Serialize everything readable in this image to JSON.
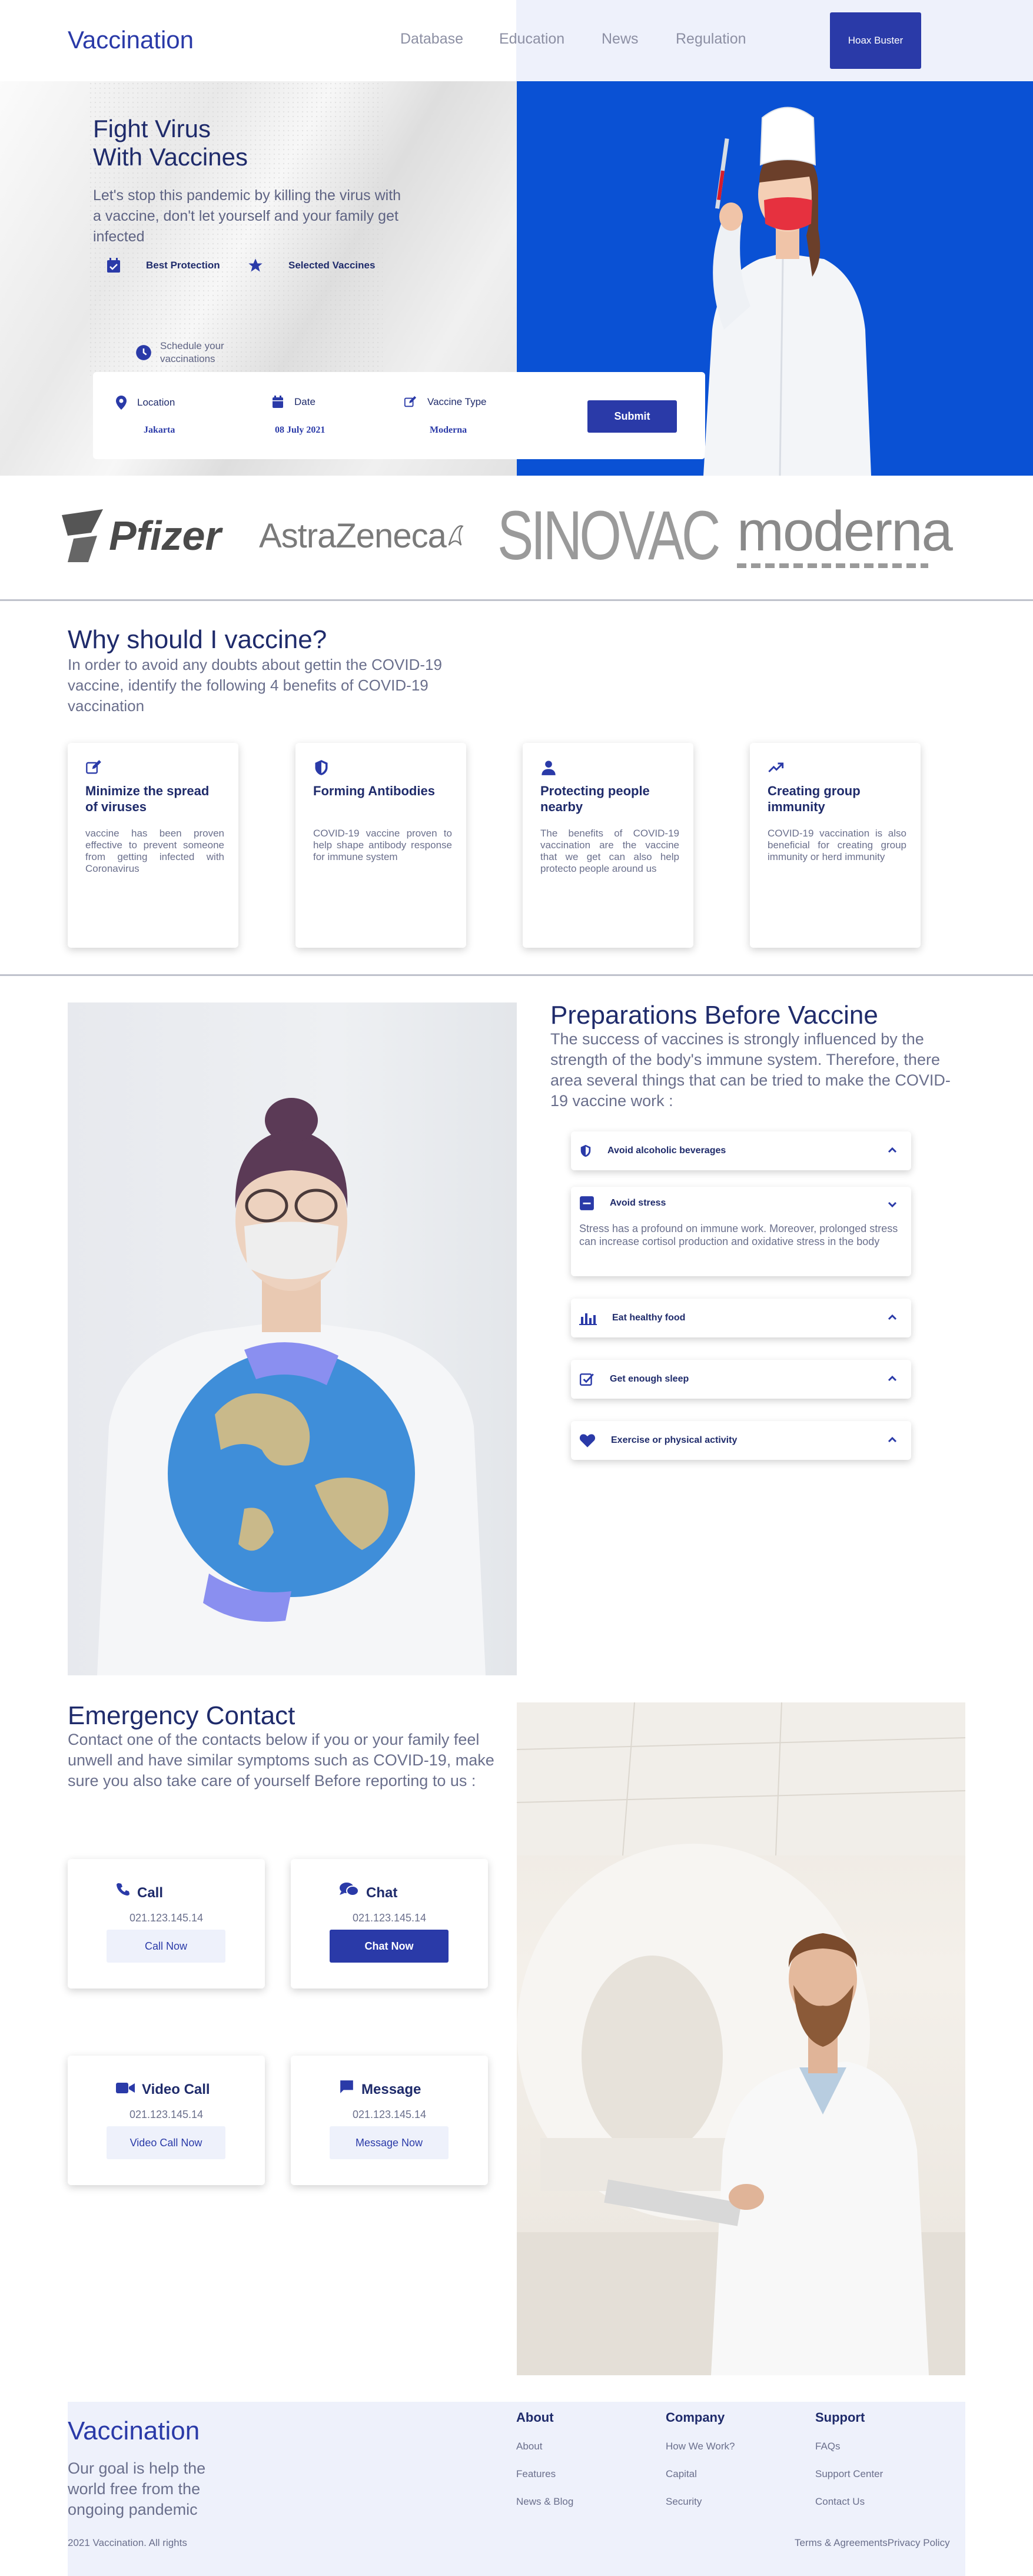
{
  "header": {
    "logo": "Vaccination",
    "nav": [
      "Database",
      "Education",
      "News",
      "Regulation"
    ],
    "cta": "Hoax Buster"
  },
  "hero": {
    "title_line1": "Fight Virus",
    "title_line2": "With Vaccines",
    "subtitle": "Let's stop this pandemic by killing the virus with a vaccine, don't let yourself and your family get infected",
    "features": [
      "Best Protection",
      "Selected Vaccines"
    ],
    "schedule_line1": "Schedule your",
    "schedule_line2": "vaccinations",
    "form": {
      "location_label": "Location",
      "location_value": "Jakarta",
      "date_label": "Date",
      "date_value": "08 July 2021",
      "type_label": "Vaccine Type",
      "type_value": "Moderna",
      "submit": "Submit"
    }
  },
  "brands": [
    "Pfizer",
    "AstraZeneca",
    "SINOVAC",
    "moderna"
  ],
  "why": {
    "title": "Why should I vaccine?",
    "subtitle": "In order to avoid any doubts about gettin the COVID-19 vaccine, identify the following 4 benefits of COVID-19 vaccination",
    "cards": [
      {
        "icon": "edit-icon",
        "title": "Minimize the spread of viruses",
        "text": "vaccine has been proven effective to prevent someone from getting infected with Coronavirus"
      },
      {
        "icon": "shield-icon",
        "title": "Forming Antibodies",
        "text": "COVID-19 vaccine proven to help shape antibody response for immune system"
      },
      {
        "icon": "user-icon",
        "title": "Protecting people nearby",
        "text": "The benefits of COVID-19 vaccination are the vaccine that we get can also help protecto people around us"
      },
      {
        "icon": "trend-up-icon",
        "title": "Creating group immunity",
        "text": "COVID-19 vaccination is also beneficial for creating group immunity or herd immunity"
      }
    ]
  },
  "prep": {
    "title": "Preparations Before Vaccine",
    "subtitle": "The success of vaccines is strongly influenced by the strength of the body's immune system. Therefore, there area several things that can be tried to make the COVID-19 vaccine work :",
    "items": [
      {
        "icon": "shield-icon",
        "label": "Avoid alcoholic beverages",
        "expanded": false
      },
      {
        "icon": "minus-square-icon",
        "label": "Avoid stress",
        "expanded": true,
        "body": "Stress has a profound on immune work. Moreover, prolonged stress can increase cortisol production and oxidative stress in the body"
      },
      {
        "icon": "bar-chart-icon",
        "label": "Eat healthy food",
        "expanded": false
      },
      {
        "icon": "check-square-icon",
        "label": "Get enough sleep",
        "expanded": false
      },
      {
        "icon": "heart-icon",
        "label": "Exercise or physical activity",
        "expanded": false
      }
    ]
  },
  "emergency": {
    "title": "Emergency Contact",
    "subtitle": "Contact one of the contacts below if you or your family feel unwell and have similar symptoms such as COVID-19, make sure you also take care of yourself Before reporting to us :",
    "contacts": [
      {
        "icon": "phone-icon",
        "title": "Call",
        "number": "021.123.145.14",
        "button": "Call Now"
      },
      {
        "icon": "chat-icon",
        "title": "Chat",
        "number": "021.123.145.14",
        "button": "Chat Now"
      },
      {
        "icon": "video-icon",
        "title": "Video Call",
        "number": "021.123.145.14",
        "button": "Video Call Now"
      },
      {
        "icon": "message-icon",
        "title": "Message",
        "number": "021.123.145.14",
        "button": "Message Now"
      }
    ]
  },
  "footer": {
    "logo": "Vaccination",
    "goal": "Our goal is help the world free from the ongoing pandemic",
    "copyright": "2021 Vaccination. All rights",
    "columns": [
      {
        "title": "About",
        "links": [
          "About",
          "Features",
          "News & Blog"
        ]
      },
      {
        "title": "Company",
        "links": [
          "How We Work?",
          "Capital",
          "Security"
        ]
      },
      {
        "title": "Support",
        "links": [
          "FAQs",
          "Support Center",
          "Contact Us"
        ]
      }
    ],
    "terms": "Terms & Agreements",
    "privacy": "Privacy Policy"
  },
  "colors": {
    "primary": "#2a3aa8",
    "hero_blue": "#0a51d4",
    "panel": "#eef1fb",
    "heading": "#1f2b6b",
    "muted": "#6a6f8c"
  }
}
